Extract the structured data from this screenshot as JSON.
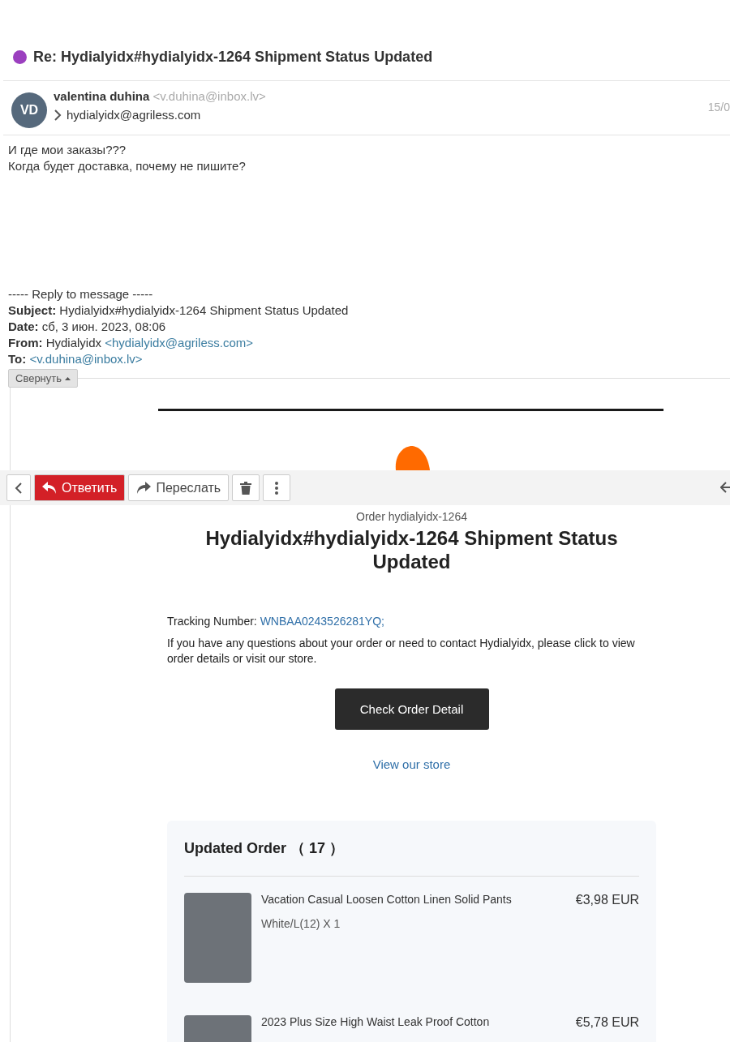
{
  "message": {
    "subject": "Re: Hydialyidx#hydialyidx-1264 Shipment Status Updated",
    "sender": {
      "initials": "VD",
      "name": "valentina duhina",
      "email": "<v.duhina@inbox.lv>",
      "recipient": "hydialyidx@agriless.com",
      "date": "15/0"
    },
    "body": [
      "И где мои заказы???",
      "Когда будет доставка, почему не пишите?"
    ],
    "quote": {
      "heading": "----- Reply to message -----",
      "fields": [
        {
          "label": "Subject:",
          "value": "Hydialyidx#hydialyidx-1264 Shipment Status Updated"
        },
        {
          "label": "Date:",
          "value": "сб, 3 июн. 2023, 08:06"
        },
        {
          "label": "From:",
          "value": "Hydialyidx",
          "link": "<hydialyidx@agriless.com>"
        },
        {
          "label": "To:",
          "link": "<v.duhina@inbox.lv>"
        }
      ],
      "collapse_button": "Свернуть"
    }
  },
  "toolbar": {
    "reply": "Ответить",
    "forward": "Переслать"
  },
  "email": {
    "order_label": "Order hydialyidx-1264",
    "heading": "Hydialyidx#hydialyidx-1264 Shipment Status Updated",
    "tracking_label": "Tracking Number:",
    "tracking_number": "WNBAA0243526281YQ;",
    "info": "If you have any questions about your order or need to contact Hydialyidx, please click to view order details or visit our store.",
    "button": "Check Order Detail",
    "store_link": "View our store",
    "order": {
      "title": "Updated Order （ 17 ）",
      "items": [
        {
          "name": "Vacation Casual Loosen Cotton Linen Solid Pants",
          "variant": "White/L(12) X 1",
          "price": "€3,98 EUR"
        },
        {
          "name": "2023 Plus Size High Waist Leak Proof Cotton",
          "price": "€5,78 EUR"
        }
      ]
    }
  }
}
